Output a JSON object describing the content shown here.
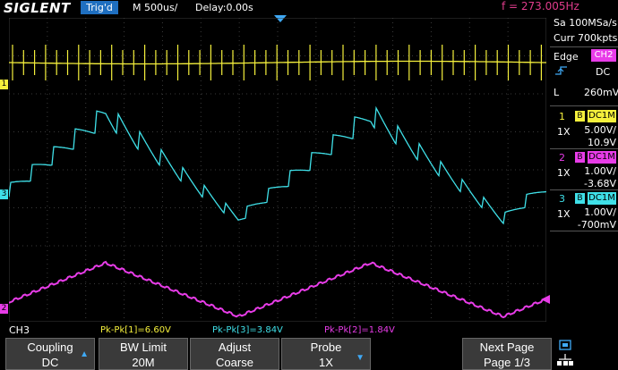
{
  "header": {
    "logo": "SIGLENT",
    "trig_status": "Trig'd",
    "timebase": "M 500us/",
    "delay": "Delay:0.00s",
    "frequency": "f = 273.005Hz"
  },
  "acquisition": {
    "sample_rate": "Sa 100MSa/s",
    "memory": "Curr 700kpts"
  },
  "trigger": {
    "type_label": "Edge",
    "source": "CH2",
    "coupling": "DC",
    "level_label": "L",
    "level": "260mV"
  },
  "channels": [
    {
      "num": "1",
      "bw": "B",
      "coupling": "DC1M",
      "probe": "1X",
      "scale": "5.00V/",
      "offset": "10.9V",
      "color": "#f5f03c"
    },
    {
      "num": "2",
      "bw": "B",
      "coupling": "DC1M",
      "probe": "1X",
      "scale": "1.00V/",
      "offset": "-3.68V",
      "color": "#e83ce8"
    },
    {
      "num": "3",
      "bw": "B",
      "coupling": "DC1M",
      "probe": "1X",
      "scale": "1.00V/",
      "offset": "-700mV",
      "color": "#3fe0e8"
    }
  ],
  "markers": {
    "ch1": "1",
    "ch2": "2",
    "ch3": "3"
  },
  "status": {
    "active_channel": "CH3",
    "meas1": "Pk-Pk[1]=6.60V",
    "meas3": "Pk-Pk[3]=3.84V",
    "meas2": "Pk-Pk[2]=1.84V"
  },
  "menu": {
    "coupling_label": "Coupling",
    "coupling_value": "DC",
    "bw_label": "BW Limit",
    "bw_value": "20M",
    "adjust_label": "Adjust",
    "adjust_value": "Coarse",
    "probe_label": "Probe",
    "probe_value": "1X",
    "next_label": "Next Page",
    "next_value": "Page 1/3"
  },
  "colors": {
    "ch1": "#f5f03c",
    "ch2": "#e83ce8",
    "ch3": "#3fe0e8",
    "accent": "#1f6fc0",
    "freq": "#e03c8c"
  },
  "icons": [
    "up-arrow-icon",
    "down-arrow-icon",
    "trigger-edge-icon",
    "network-icon",
    "usb-icon"
  ]
}
